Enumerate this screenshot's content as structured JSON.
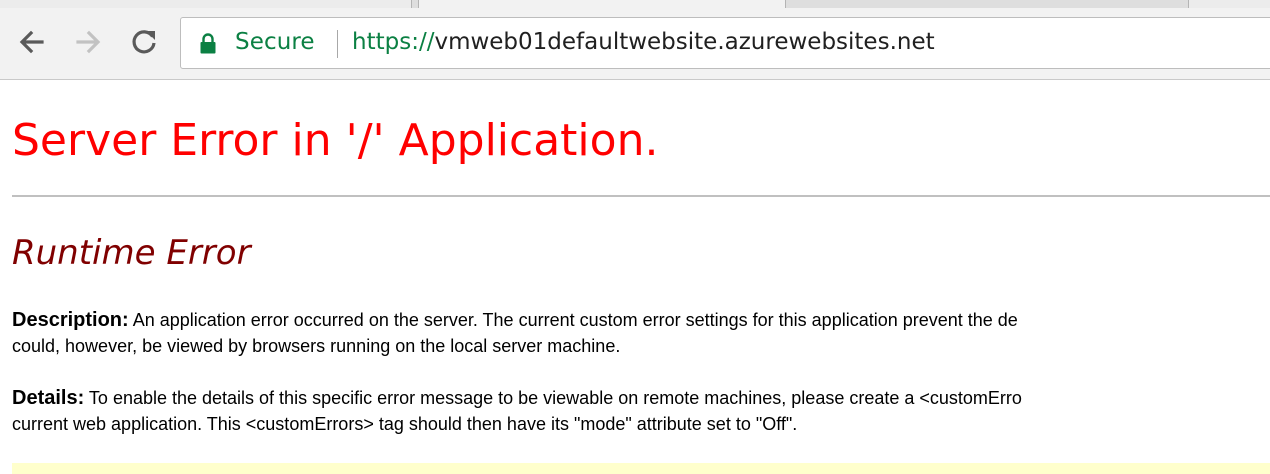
{
  "browser": {
    "security_label": "Secure",
    "url_scheme": "https://",
    "url_host": "vmweb01defaultwebsite.azurewebsites.net",
    "icons": {
      "back": "arrow-left-icon",
      "forward": "arrow-right-icon",
      "reload": "reload-icon",
      "security": "lock-icon"
    },
    "colors": {
      "secure_green": "#0b8043"
    }
  },
  "page": {
    "title": "Server Error in '/' Application.",
    "subtitle": "Runtime Error",
    "description": {
      "label": "Description:",
      "line1": " An application error occurred on the server. The current custom error settings for this application prevent the de",
      "line2": "could, however, be viewed by browsers running on the local server machine."
    },
    "details": {
      "label": "Details:",
      "line1": " To enable the details of this specific error message to be viewable on remote machines, please create a <customErro",
      "line2": "current web application. This <customErrors> tag should then have its \"mode\" attribute set to \"Off\"."
    },
    "colors": {
      "title": "#ff0000",
      "subtitle": "#800000",
      "code_background": "#ffffcc"
    }
  }
}
